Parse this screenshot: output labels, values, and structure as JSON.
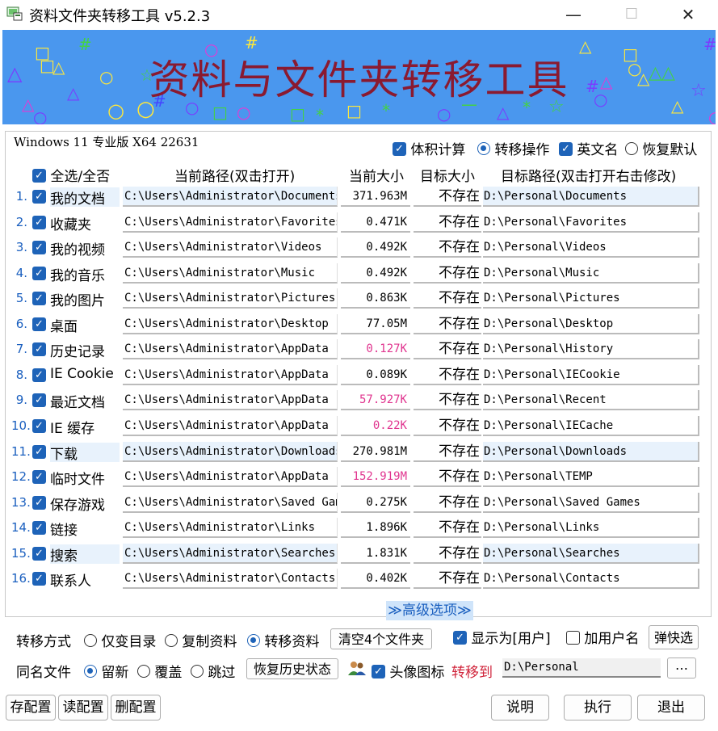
{
  "window": {
    "title": "资料文件夹转移工具 v5.2.3",
    "minimize": "—",
    "maximize": "☐",
    "close": "✕"
  },
  "banner": {
    "title": "资料与文件夹转移工具",
    "bg_color": "#4a97ee",
    "title_color": "#8a1a30"
  },
  "os_info": "Windows 11 专业版  X64 22631",
  "top_options": {
    "size_calc": {
      "label": "体积计算",
      "checked": true
    },
    "transfer_op": {
      "label": "转移操作",
      "selected": true
    },
    "english_name": {
      "label": "英文名",
      "checked": true
    },
    "restore_default": {
      "label": "恢复默认",
      "selected": false
    }
  },
  "table": {
    "select_all": "全选/全否",
    "headers": {
      "current_path": "当前路径(双击打开)",
      "current_size": "当前大小",
      "target_size": "目标大小",
      "target_path": "目标路径(双击打开右击修改)"
    },
    "rows": [
      {
        "num": "1.",
        "name": "我的文档",
        "path": "C:\\Users\\Administrator\\Documents",
        "size": "371.963M",
        "pink": false,
        "tsize": "不存在",
        "tpath": "D:\\Personal\\Documents"
      },
      {
        "num": "2.",
        "name": "收藏夹",
        "path": "C:\\Users\\Administrator\\Favorites",
        "size": "0.471K",
        "pink": false,
        "tsize": "不存在",
        "tpath": "D:\\Personal\\Favorites"
      },
      {
        "num": "3.",
        "name": "我的视频",
        "path": "C:\\Users\\Administrator\\Videos",
        "size": "0.492K",
        "pink": false,
        "tsize": "不存在",
        "tpath": "D:\\Personal\\Videos"
      },
      {
        "num": "4.",
        "name": "我的音乐",
        "path": "C:\\Users\\Administrator\\Music",
        "size": "0.492K",
        "pink": false,
        "tsize": "不存在",
        "tpath": "D:\\Personal\\Music"
      },
      {
        "num": "5.",
        "name": "我的图片",
        "path": "C:\\Users\\Administrator\\Pictures",
        "size": "0.863K",
        "pink": false,
        "tsize": "不存在",
        "tpath": "D:\\Personal\\Pictures"
      },
      {
        "num": "6.",
        "name": "桌面",
        "path": "C:\\Users\\Administrator\\Desktop",
        "size": "77.05M",
        "pink": false,
        "tsize": "不存在",
        "tpath": "D:\\Personal\\Desktop"
      },
      {
        "num": "7.",
        "name": "历史记录",
        "path": "C:\\Users\\Administrator\\AppData",
        "size": "0.127K",
        "pink": true,
        "tsize": "不存在",
        "tpath": "D:\\Personal\\History"
      },
      {
        "num": "8.",
        "name": "IE Cookie",
        "path": "C:\\Users\\Administrator\\AppData",
        "size": "0.089K",
        "pink": false,
        "tsize": "不存在",
        "tpath": "D:\\Personal\\IECookie"
      },
      {
        "num": "9.",
        "name": "最近文档",
        "path": "C:\\Users\\Administrator\\AppData",
        "size": "57.927K",
        "pink": true,
        "tsize": "不存在",
        "tpath": "D:\\Personal\\Recent"
      },
      {
        "num": "10.",
        "name": "IE 缓存",
        "path": "C:\\Users\\Administrator\\AppData",
        "size": "0.22K",
        "pink": true,
        "tsize": "不存在",
        "tpath": "D:\\Personal\\IECache"
      },
      {
        "num": "11.",
        "name": "下载",
        "path": "C:\\Users\\Administrator\\Downloads",
        "size": "270.981M",
        "pink": false,
        "tsize": "不存在",
        "tpath": "D:\\Personal\\Downloads"
      },
      {
        "num": "12.",
        "name": "临时文件",
        "path": "C:\\Users\\Administrator\\AppData",
        "size": "152.919M",
        "pink": true,
        "tsize": "不存在",
        "tpath": "D:\\Personal\\TEMP"
      },
      {
        "num": "13.",
        "name": "保存游戏",
        "path": "C:\\Users\\Administrator\\Saved Games",
        "size": "0.275K",
        "pink": false,
        "tsize": "不存在",
        "tpath": "D:\\Personal\\Saved Games"
      },
      {
        "num": "14.",
        "name": "链接",
        "path": "C:\\Users\\Administrator\\Links",
        "size": "1.896K",
        "pink": false,
        "tsize": "不存在",
        "tpath": "D:\\Personal\\Links"
      },
      {
        "num": "15.",
        "name": "搜索",
        "path": "C:\\Users\\Administrator\\Searches",
        "size": "1.831K",
        "pink": false,
        "tsize": "不存在",
        "tpath": "D:\\Personal\\Searches"
      },
      {
        "num": "16.",
        "name": "联系人",
        "path": "C:\\Users\\Administrator\\Contacts",
        "size": "0.402K",
        "pink": false,
        "tsize": "不存在",
        "tpath": "D:\\Personal\\Contacts"
      }
    ]
  },
  "advanced_toggle": "≫高级选项≫",
  "transfer_mode": {
    "label": "转移方式",
    "options": [
      {
        "label": "仅变目录",
        "selected": false
      },
      {
        "label": "复制资料",
        "selected": false
      },
      {
        "label": "转移资料",
        "selected": true
      }
    ],
    "clear_button": "清空4个文件夹",
    "show_as_user": {
      "label": "显示为[用户]",
      "checked": true
    },
    "add_username": {
      "label": "加用户名",
      "checked": false
    },
    "quick_select": "弹快选"
  },
  "same_name": {
    "label": "同名文件",
    "options": [
      {
        "label": "留新",
        "selected": true
      },
      {
        "label": "覆盖",
        "selected": false
      },
      {
        "label": "跳过",
        "selected": false
      }
    ],
    "restore_history": "恢复历史状态",
    "avatar_icon": {
      "label": "头像图标",
      "checked": true
    },
    "transfer_to_label": "转移到",
    "destination": "D:\\Personal",
    "browse": "…"
  },
  "footer": {
    "save_config": "存配置",
    "read_config": "读配置",
    "delete_config": "删配置",
    "help": "说明",
    "execute": "执行",
    "exit": "退出"
  },
  "colors": {
    "accent": "#1e63b8",
    "pink_size": "#e0358f",
    "row_highlight": "#e8f2fc",
    "red_label": "#d0233a"
  }
}
